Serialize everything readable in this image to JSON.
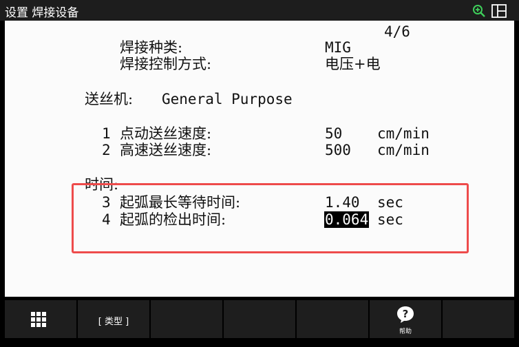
{
  "window": {
    "title": "设置 焊接设备"
  },
  "page_indicator": "4/6",
  "welding": {
    "type_label": "焊接种类:",
    "type_value": "MIG",
    "control_label": "焊接控制方式:",
    "control_value": "电压+电"
  },
  "wire_feeder": {
    "label": "送丝机:",
    "value": "General Purpose"
  },
  "speed_items": [
    {
      "num": "1",
      "label": "点动送丝速度:",
      "value": "50",
      "unit": "cm/min"
    },
    {
      "num": "2",
      "label": "高速送丝速度:",
      "value": "500",
      "unit": "cm/min"
    }
  ],
  "time_section": {
    "label": "时间:"
  },
  "time_items": [
    {
      "num": "3",
      "label": "起弧最长等待时间:",
      "value": "1.40",
      "unit": "sec"
    },
    {
      "num": "4",
      "label": "起弧的检出时间:",
      "value": "0.064",
      "unit": "sec"
    }
  ],
  "softkeys": {
    "type_label": "[ 类型 ]",
    "help_label": "帮助"
  },
  "icons": {
    "zoom": "zoom-in-icon",
    "layout": "split-window-icon",
    "menu": "grid-menu-icon",
    "help": "help-icon"
  },
  "colors": {
    "highlight_border": "#ee4b4b",
    "zoom_icon": "#3ecf5a"
  }
}
